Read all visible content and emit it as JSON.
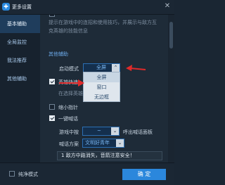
{
  "window": {
    "title": "更多设置",
    "close_glyph": "✕",
    "title_icon_glyph": "✚"
  },
  "sidebar": {
    "items": [
      {
        "label": "基本辅助",
        "active": true
      },
      {
        "label": "全局监控",
        "active": false
      },
      {
        "label": "我法推荐",
        "active": false
      },
      {
        "label": "其他辅助",
        "active": false
      }
    ]
  },
  "content": {
    "top_desc_line1": "提示在游戏中的连招和使用技巧，并展示与敌方互",
    "top_desc_line2": "克英雄的技能信息",
    "section_title": "其他辅助",
    "launch_mode": {
      "label": "启动模式",
      "value": "全屏",
      "options": [
        "全屏",
        "窗口",
        "无边框"
      ],
      "selected_index": 0
    },
    "hero_quick": {
      "label": "英雄快速",
      "checked": true
    },
    "hero_quick_desc": "在选择英雄",
    "small_pointer": {
      "label": "缩小指针",
      "checked": false
    },
    "one_key_shout": {
      "label": "一键喊话",
      "checked": true
    },
    "game_shout": {
      "label": "游戏中按",
      "value": "~",
      "suffix": "呼出喊话面板"
    },
    "shout_scheme": {
      "label": "喊话方案",
      "value": "文明好青年"
    },
    "notice_text": "1  敌方中路消失，音箭注意安全！"
  },
  "footer": {
    "pure_mode_label": "纯净模式",
    "ok_label": "确  定"
  },
  "colors": {
    "accent": "#2b87dc",
    "annotation_red": "#e02a2a",
    "background": "#1a2633"
  }
}
